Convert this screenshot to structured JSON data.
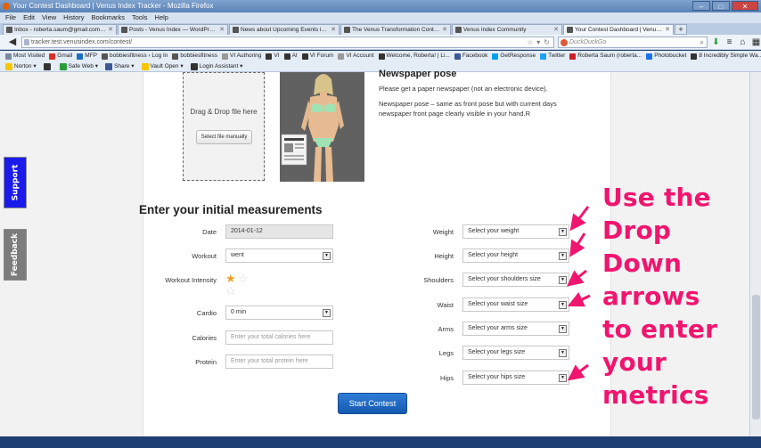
{
  "window": {
    "title": "Your Contest Dashboard | Venus Index Tracker - Mozilla Firefox"
  },
  "menu": [
    "File",
    "Edit",
    "View",
    "History",
    "Bookmarks",
    "Tools",
    "Help"
  ],
  "tabs": [
    {
      "label": "Inbox - roberta.saum@gmail.com - G...",
      "icon_color": "#d93025"
    },
    {
      "label": "Posts - Venus Index — WordPress",
      "icon_color": "#464646"
    },
    {
      "label": "News about Upcoming Events in the ...",
      "icon_color": "#333333"
    },
    {
      "label": "The Venus Transformation Contest",
      "icon_color": "#333333"
    },
    {
      "label": "Venus Index Community",
      "icon_color": "#333333"
    },
    {
      "label": "Your Contest Dashboard | Venus Inde...",
      "icon_color": "#333333"
    }
  ],
  "nav": {
    "url": "tracker.test.venusindex.com/contest/",
    "search_placeholder": "DuckDuckGo"
  },
  "bookmarks": [
    {
      "label": "Most Visited",
      "color": "#7a8aa0"
    },
    {
      "label": "Gmail",
      "color": "#d93025"
    },
    {
      "label": "MFP",
      "color": "#1b6ec2"
    },
    {
      "label": "bobbiesfitness › Log In",
      "color": "#555555"
    },
    {
      "label": "bobbiesfitness",
      "color": "#555555"
    },
    {
      "label": "VI Authoring",
      "color": "#999999"
    },
    {
      "label": "VI",
      "color": "#333333"
    },
    {
      "label": "AI",
      "color": "#333333"
    },
    {
      "label": "VI Forum",
      "color": "#333333"
    },
    {
      "label": "VI Account",
      "color": "#999999"
    },
    {
      "label": "Welcome, Roberta! | Li...",
      "color": "#333333"
    },
    {
      "label": "Facebook",
      "color": "#3b5998"
    },
    {
      "label": "GetResponse",
      "color": "#00a2e8"
    },
    {
      "label": "Twitter",
      "color": "#1da1f2"
    },
    {
      "label": "Roberta Saum (roberta...",
      "color": "#cb2027"
    },
    {
      "label": "Photobucket",
      "color": "#1a73e8"
    },
    {
      "label": "8 Incredibly Simple Wa...",
      "color": "#333333"
    }
  ],
  "norton": [
    {
      "label": "Norton ▾",
      "color": "#f7c600"
    },
    {
      "label": "",
      "color": "#333333"
    },
    {
      "label": "Safe Web ▾",
      "color": "#2a9d3a"
    },
    {
      "label": "Share ▾",
      "color": "#3b5998"
    },
    {
      "label": "Vault Open ▾",
      "color": "#f7c600"
    },
    {
      "label": "Login Assistant ▾",
      "color": "#333333"
    }
  ],
  "side": {
    "support": "Support",
    "feedback": "Feedback"
  },
  "upload": {
    "drop_text": "Drag & Drop file here",
    "button": "Select file manually"
  },
  "pose": {
    "title": "Newspaper pose",
    "line1": "Please get a paper newspaper (not an electronic device).",
    "line2": "Newspaper pose – same as front pose but with current days newspaper front page clearly visible in your hand.R"
  },
  "form": {
    "section_title": "Enter your initial measurements",
    "date_label": "Date",
    "date_value": "2014-01-12",
    "workout_label": "Workout",
    "workout_value": "went",
    "intensity_label": "Workout Intensity",
    "intensity_rating": 1,
    "intensity_max": 2,
    "cardio_label": "Cardio",
    "cardio_value": "0 min",
    "calories_label": "Calories",
    "calories_placeholder": "Enter your total calories here",
    "protein_label": "Protein",
    "protein_placeholder": "Enter your total protein here",
    "weight_label": "Weight",
    "weight_value": "Select your weight",
    "height_label": "Height",
    "height_value": "Select your height",
    "shoulders_label": "Shoulders",
    "shoulders_value": "Select your shoulders size",
    "waist_label": "Waist",
    "waist_value": "Select your waist size",
    "arms_label": "Arms",
    "arms_value": "Select your arms size",
    "legs_label": "Legs",
    "legs_value": "Select your legs size",
    "hips_label": "Hips",
    "hips_value": "Select your hips size",
    "submit": "Start Contest"
  },
  "annotation": {
    "lines": [
      "Use the",
      "Drop Down",
      "arrows",
      "to enter",
      "your",
      "metrics"
    ],
    "color": "#f0156e"
  }
}
